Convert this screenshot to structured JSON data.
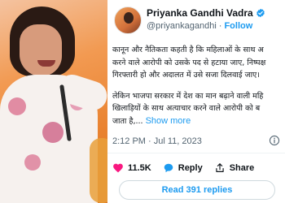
{
  "author": {
    "name": "Priyanka Gandhi Vadra",
    "handle": "@priyankagandhi",
    "separator": "·",
    "follow_label": "Follow",
    "verified_icon": "verified-badge-icon",
    "verified_color": "#1d9bf0"
  },
  "tweet": {
    "lines": [
      "कानून और नैतिकता कहती है कि महिलाओं के साथ अ",
      "करने वाले आरोपी को उसके पद से हटाया जाए, निष्पक्ष",
      "गिरफ्तारी हो और अदालत में उसे सजा दिलवाई जाए।",
      "लेकिन भाजपा सरकार में देश का मान बढ़ाने वाली महि",
      "खिलाड़ियों के साथ अत्याचार करने वाले आरोपी को ब",
      "जाता है,..."
    ],
    "show_more_label": "Show more",
    "timestamp": "2:12 PM · Jul 11, 2023"
  },
  "actions": {
    "like_count": "11.5K",
    "reply_label": "Reply",
    "share_label": "Share",
    "like_color": "#f91880",
    "reply_color": "#1d9bf0"
  },
  "replies_button": {
    "label": "Read 391 replies"
  },
  "colors": {
    "accent": "#1d9bf0",
    "text": "#0f1419",
    "muted": "#536471"
  }
}
